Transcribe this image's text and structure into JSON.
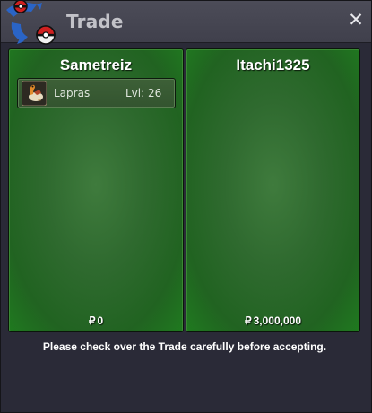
{
  "window": {
    "title": "Trade",
    "close_label": "✕"
  },
  "traders": [
    {
      "name": "Sametreiz",
      "items": [
        {
          "icon": "lapras-icon",
          "name": "Lapras",
          "level": "Lvl: 26"
        }
      ],
      "currency_symbol": "₽",
      "money": "0"
    },
    {
      "name": "Itachi1325",
      "items": [],
      "currency_symbol": "₽",
      "money": "3,000,000"
    }
  ],
  "footer": {
    "notice": "Please check over the Trade carefully before accepting."
  },
  "colors": {
    "panel_green": "#2f6a2f",
    "titlebar": "#4c4c58",
    "background": "#2a2a37"
  }
}
